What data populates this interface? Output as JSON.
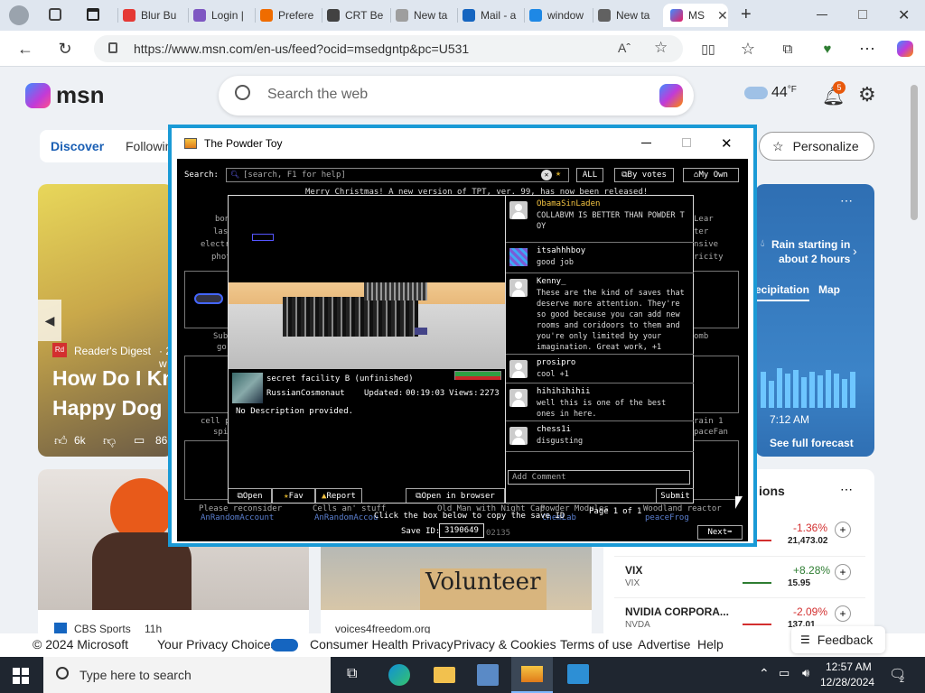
{
  "browser": {
    "tabs": [
      {
        "label": "Blur Bu",
        "color": "#e53935"
      },
      {
        "label": "Login |",
        "color": "#7e57c2"
      },
      {
        "label": "Prefere",
        "color": "#ef6c00"
      },
      {
        "label": "CRT Be",
        "color": "#424242"
      },
      {
        "label": "New ta",
        "color": "#9e9e9e"
      },
      {
        "label": "Mail - a",
        "color": "#1565c0"
      },
      {
        "label": "window",
        "color": "#1e88e5"
      },
      {
        "label": "New ta",
        "color": "#616161"
      },
      {
        "label": "MS",
        "color": "#e91e63"
      }
    ],
    "url": "https://www.msn.com/en-us/feed?ocid=msedgntp&pc=U531",
    "read_aloud_label": "Aˆ"
  },
  "msn": {
    "logo": "msn",
    "search_placeholder": "Search the web",
    "weather_temp": "44",
    "weather_unit": "°F",
    "notif_count": "5",
    "nav_discover": "Discover",
    "nav_following": "Following",
    "personalize": "Personalize",
    "hero_source": "Reader's Digest",
    "hero_time": "· 2 w",
    "hero_title_1": "How Do I Kn",
    "hero_title_2": "Happy Dog",
    "hero_likes": "6k",
    "hero_comments": "86",
    "weather_rain_1": "Rain starting in",
    "weather_rain_2": "about 2 hours",
    "weather_tab_precip": "ecipitation",
    "weather_tab_map": "Map",
    "weather_time": "7:12 AM",
    "see_forecast": "See full forecast",
    "markets_title_frag": "ions",
    "markets": [
      {
        "name": "",
        "ticker": "",
        "change": "-1.36%",
        "price": "21,473.02",
        "color": "#d32f2f"
      },
      {
        "name": "VIX",
        "ticker": "VIX",
        "change": "+8.28%",
        "price": "15.95",
        "color": "#2e7d32"
      },
      {
        "name": "NVIDIA CORPORA...",
        "ticker": "NVDA",
        "change": "-2.09%",
        "price": "137.01",
        "color": "#d32f2f"
      }
    ],
    "card2_source": "CBS Sports",
    "card2_time": "11h",
    "card3_source": "voices4freedom.org",
    "card3_sign": "Volunteer",
    "footer": {
      "copyright": "© 2024 Microsoft",
      "privacy_choices": "Your Privacy Choices",
      "consumer_health": "Consumer Health Privacy",
      "privacy_cookies": "Privacy & Cookies",
      "terms": "Terms of use",
      "advertise": "Advertise",
      "help": "Help",
      "feedback": "Feedback"
    }
  },
  "tpt": {
    "window_title": "The Powder Toy",
    "search_label": "Search:",
    "search_placeholder": "[search, F1 for help]",
    "filter_all": "ALL",
    "by_votes": "By votes",
    "my_own": "My Own",
    "notice": "Merry Christmas! A new version of TPT, ver. 99, has now been released!",
    "save_title": "secret facility B (unfinished)",
    "author": "RussianCosmonaut",
    "updated_label": "Updated:",
    "updated_time": "00:19:03",
    "views_label": "Views:",
    "views": "2273",
    "description": "No Description provided.",
    "btn_open": "Open",
    "btn_fav": "Fav",
    "btn_report": "Report",
    "btn_open_browser": "Open in browser",
    "add_comment_placeholder": "Add Comment",
    "submit": "Submit",
    "comments": [
      {
        "user": "ObamaSinLaden",
        "text": "COLLABVM IS BETTER THAN POWDER T OY",
        "user_color": "#f5c542",
        "avatar": "person"
      },
      {
        "user": "itsahhhboy",
        "text": "good job",
        "user_color": "#ffffff",
        "avatar": "tile"
      },
      {
        "user": "Kenny_",
        "text": "These are the kind of saves that deserve more attention. They're so good because you can add new rooms and coridoors to them and you're only limited by your imagination. Great work, +1",
        "user_color": "#ffffff",
        "avatar": "person"
      },
      {
        "user": "prosipro",
        "text": "cool +1",
        "user_color": "#ffffff",
        "avatar": "person"
      },
      {
        "user": "hihihihihii",
        "text": "well this is one of the best ones in here.",
        "user_color": "#ffffff",
        "avatar": "person"
      },
      {
        "user": "chess1i",
        "text": "disgusting",
        "user_color": "#ffffff",
        "avatar": "person"
      }
    ],
    "copy_hint": "Click the box below to copy the save ID",
    "save_id_label": "Save ID:",
    "save_id": "3190649",
    "page_label": "Page",
    "page_current": "1",
    "page_of": "of",
    "page_total": "1",
    "next": "Next",
    "bg_items_left": [
      "bon",
      "las",
      "electr",
      "phot",
      "Sub",
      "go",
      "cell p",
      "spi"
    ],
    "bg_items_right": [
      "Lear",
      "ter",
      "nsive",
      "ricity",
      "omb",
      "rain 1",
      "paceFan"
    ],
    "bg_bottom": [
      {
        "title": "Please reconsider",
        "author": "AnRandomAccount"
      },
      {
        "title": "Cells an' stuff",
        "author": "AnRandomAccou"
      },
      {
        "title": "Old Man with Night Cap",
        "author": ""
      },
      {
        "title": "Powder Modules",
        "author": "ChemLab"
      },
      {
        "title": "Woodland reactor",
        "author": "peaceFrog"
      }
    ],
    "bg_bottom_frag": "02135"
  },
  "taskbar": {
    "search_placeholder": "Type here to search",
    "time": "12:57 AM",
    "date": "12/28/2024",
    "notif": "2"
  }
}
